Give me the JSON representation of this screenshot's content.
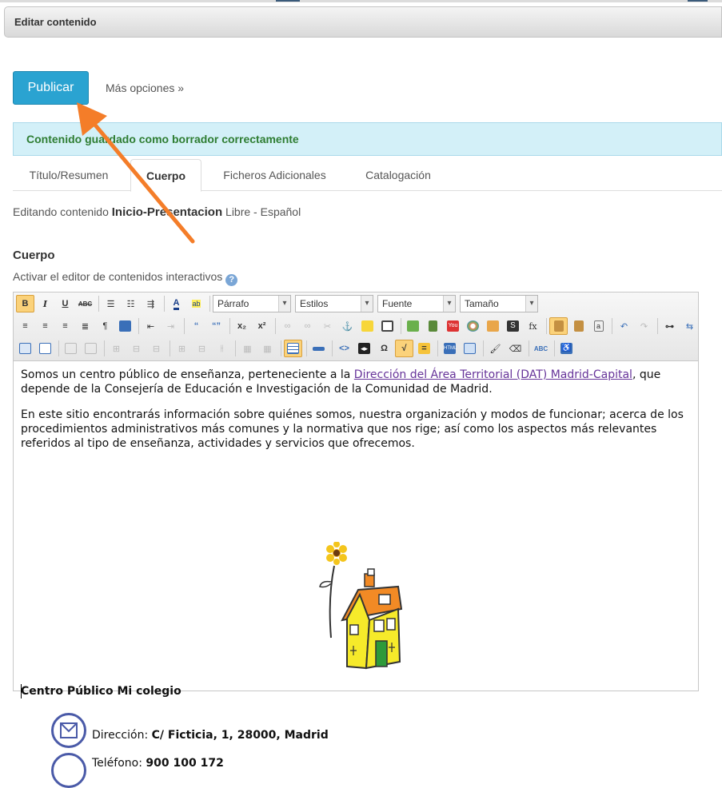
{
  "window": {
    "title": "Editar contenido"
  },
  "actions": {
    "publish_label": "Publicar",
    "more_label": "Más opciones »"
  },
  "alert": {
    "text": "Contenido guardado como borrador correctamente"
  },
  "tabs": [
    {
      "label": "Título/Resumen"
    },
    {
      "label": "Cuerpo"
    },
    {
      "label": "Ficheros Adicionales"
    },
    {
      "label": "Catalogación"
    }
  ],
  "editing": {
    "prefix": "Editando contenido",
    "name": "Inicio-Presentacion",
    "meta": "Libre - Español"
  },
  "section": {
    "title": "Cuerpo",
    "interactive_label": "Activar el editor de contenidos interactivos"
  },
  "toolbar": {
    "format": "Párrafo",
    "styles": "Estilos",
    "font": "Fuente",
    "size": "Tamaño"
  },
  "content": {
    "p1_before": "Somos un centro público de enseñanza, perteneciente a la ",
    "p1_link": "Dirección del Área Territorial (DAT) Madrid-Capital",
    "p1_after": ", que depende de la Consejería de Educación e Investigación de la Comunidad de Madrid.",
    "p2": "En este sitio encontrarás información sobre quiénes somos, nuestra organización y modos de funcionar; acerca de los procedimientos administrativos más comunes y la normativa que nos rige; así como los aspectos más relevantes referidos al tipo de enseñanza, actividades y servicios que ofrecemos.",
    "center_title": "Centro Público Mi colegio",
    "address_label": "Dirección:",
    "address_value": "C/ Ficticia, 1, 28000, Madrid",
    "phone_label": "Teléfono:",
    "phone_value": "900 100 172"
  }
}
